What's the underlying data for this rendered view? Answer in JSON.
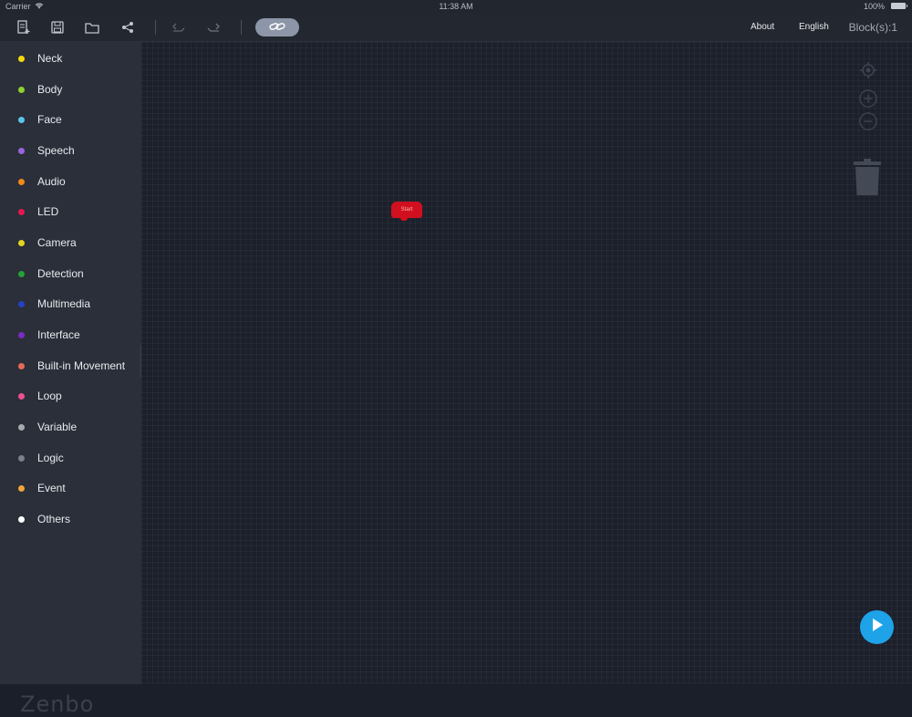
{
  "status_bar": {
    "carrier": "Carrier",
    "time": "11:38 AM",
    "battery": "100%"
  },
  "toolbar": {
    "icons": [
      "new-file-icon",
      "save-icon",
      "open-folder-icon",
      "share-icon",
      "undo-icon",
      "redo-icon",
      "link-icon"
    ],
    "about_label": "About",
    "language_label": "English",
    "block_count": "Block(s):1"
  },
  "sidebar": {
    "categories": [
      {
        "label": "Neck",
        "color": "#f5d90a"
      },
      {
        "label": "Body",
        "color": "#8fd12e"
      },
      {
        "label": "Face",
        "color": "#5cc3e8"
      },
      {
        "label": "Speech",
        "color": "#9a63e0"
      },
      {
        "label": "Audio",
        "color": "#f08a17"
      },
      {
        "label": "LED",
        "color": "#e8174f"
      },
      {
        "label": "Camera",
        "color": "#e2d51f"
      },
      {
        "label": "Detection",
        "color": "#25a035"
      },
      {
        "label": "Multimedia",
        "color": "#2741c4"
      },
      {
        "label": "Interface",
        "color": "#7a2cc4"
      },
      {
        "label": "Built-in Movement",
        "color": "#e86a55"
      },
      {
        "label": "Loop",
        "color": "#ef4f8e"
      },
      {
        "label": "Variable",
        "color": "#a7a9ad"
      },
      {
        "label": "Logic",
        "color": "#7d8088"
      },
      {
        "label": "Event",
        "color": "#f2a33a"
      },
      {
        "label": "Others",
        "color": "#ffffff"
      }
    ],
    "logo": "Zenbo"
  },
  "canvas": {
    "block_label": "Start",
    "block_color": "#d0101f",
    "controls": [
      "recenter-icon",
      "zoom-in-icon",
      "zoom-out-icon",
      "trash-icon"
    ],
    "play_color": "#1fa3e8"
  }
}
